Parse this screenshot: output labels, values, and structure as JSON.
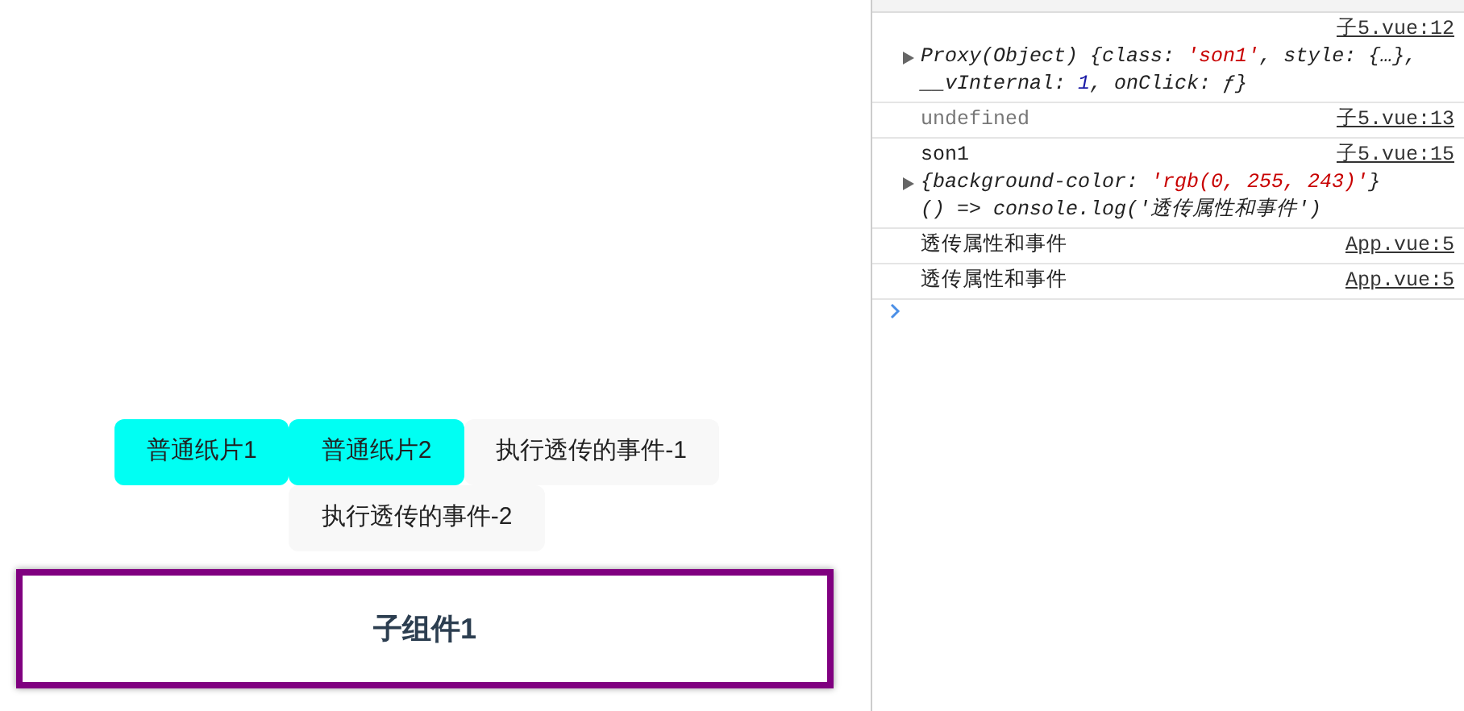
{
  "buttons": [
    {
      "label": "普通纸片1",
      "color": "#00fff3"
    },
    {
      "label": "普通纸片2",
      "color": "#00fff3"
    },
    {
      "label": "执行透传的事件-1",
      "color": "#f8f8f8"
    },
    {
      "label": "执行透传的事件-2",
      "color": "#f8f8f8"
    }
  ],
  "child_component": {
    "title": "子组件1"
  },
  "console": {
    "entries": [
      {
        "source": "子5.vue:12",
        "lines": [
          {
            "expandable": true,
            "segments": [
              {
                "kind": "plain",
                "text": "Proxy(Object) {"
              },
              {
                "kind": "key",
                "text": "class: "
              },
              {
                "kind": "string",
                "text": "'son1'"
              },
              {
                "kind": "key",
                "text": ", style: {…}, __vInternal: "
              },
              {
                "kind": "number",
                "text": "1"
              },
              {
                "kind": "key",
                "text": ", onClick: ƒ}"
              }
            ]
          }
        ]
      },
      {
        "source": "子5.vue:13",
        "lines": [
          {
            "expandable": false,
            "segments": [
              {
                "kind": "muted",
                "text": "undefined"
              }
            ]
          }
        ]
      },
      {
        "source": "子5.vue:15",
        "lines": [
          {
            "expandable": false,
            "segments": [
              {
                "kind": "text",
                "text": "son1"
              }
            ]
          },
          {
            "expandable": true,
            "segments": [
              {
                "kind": "key",
                "text": "{background-color: "
              },
              {
                "kind": "string",
                "text": "'rgb(0, 255, 243)'"
              },
              {
                "kind": "key",
                "text": "}"
              }
            ]
          },
          {
            "expandable": false,
            "segments": [
              {
                "kind": "key",
                "text": "() => console.log('透传属性和事件')"
              }
            ]
          }
        ]
      },
      {
        "source": "App.vue:5",
        "lines": [
          {
            "expandable": false,
            "segments": [
              {
                "kind": "text",
                "text": "透传属性和事件"
              }
            ]
          }
        ]
      },
      {
        "source": "App.vue:5",
        "lines": [
          {
            "expandable": false,
            "segments": [
              {
                "kind": "text",
                "text": "透传属性和事件"
              }
            ]
          }
        ]
      }
    ]
  }
}
